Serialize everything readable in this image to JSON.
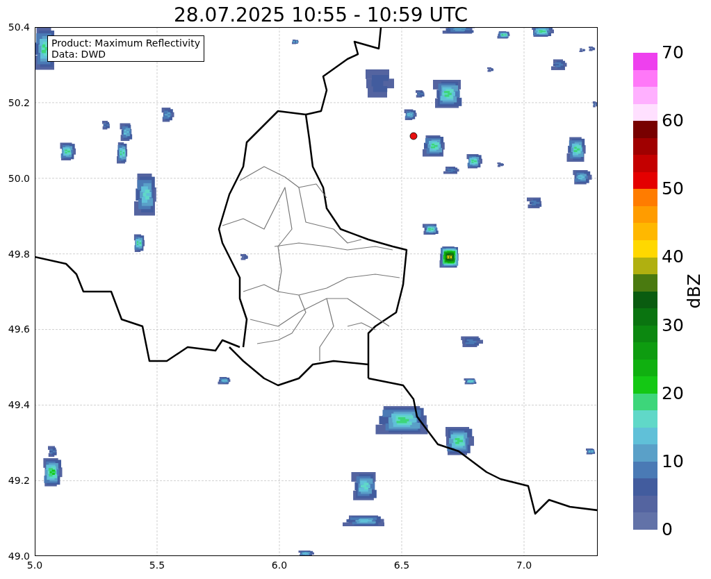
{
  "title": "28.07.2025 10:55 - 10:59 UTC",
  "info_box": {
    "product": "Product: Maximum Reflectivity",
    "data": "Data: DWD"
  },
  "map": {
    "x_ticks": [
      "5.0",
      "5.5",
      "6.0",
      "6.5",
      "7.0"
    ],
    "y_ticks": [
      "50.4",
      "50.2",
      "50.0",
      "49.8",
      "49.6",
      "49.4",
      "49.2",
      "49.0"
    ]
  },
  "colorbar": {
    "label": "dBZ",
    "ticks": [
      "70",
      "60",
      "50",
      "40",
      "30",
      "20",
      "10",
      "0"
    ],
    "bins": [
      {
        "color": "#6272a8"
      },
      {
        "color": "#5464a0"
      },
      {
        "color": "#425c9e"
      },
      {
        "color": "#4a7ab5"
      },
      {
        "color": "#5aa0c8"
      },
      {
        "color": "#60c0d8"
      },
      {
        "color": "#60d8c8"
      },
      {
        "color": "#3dd67a"
      },
      {
        "color": "#14c814"
      },
      {
        "color": "#10b010"
      },
      {
        "color": "#0e9c10"
      },
      {
        "color": "#0c8810"
      },
      {
        "color": "#0a7410"
      },
      {
        "color": "#0a5c10"
      },
      {
        "color": "#4a7a10"
      },
      {
        "color": "#b0b010"
      },
      {
        "color": "#ffd800"
      },
      {
        "color": "#ffb800"
      },
      {
        "color": "#ff9c00"
      },
      {
        "color": "#ff7c00"
      },
      {
        "color": "#e40000"
      },
      {
        "color": "#c40000"
      },
      {
        "color": "#a00000"
      },
      {
        "color": "#780000"
      },
      {
        "color": "#ffe0ff"
      },
      {
        "color": "#ffb0ff"
      },
      {
        "color": "#ff78f8"
      },
      {
        "color": "#ee40ee"
      }
    ]
  }
}
